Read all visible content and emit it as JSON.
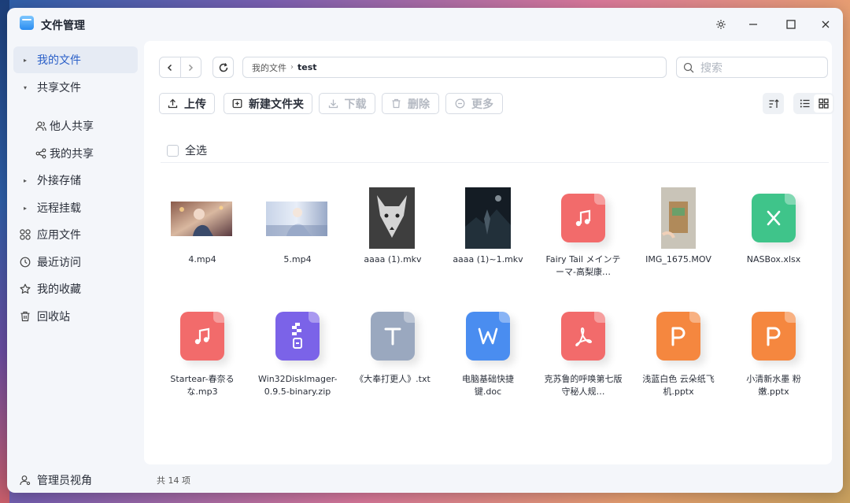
{
  "app": {
    "title": "文件管理"
  },
  "window_controls": {
    "settings": "⚙",
    "minimize": "—",
    "maximize": "☐",
    "close": "✕"
  },
  "sidebar": {
    "items": [
      {
        "label": "我的文件",
        "icon": "caret-right",
        "active": true
      },
      {
        "label": "共享文件",
        "icon": "caret-down"
      },
      {
        "label": "他人共享",
        "icon": "users-icon",
        "sub": true
      },
      {
        "label": "我的共享",
        "icon": "share-icon",
        "sub": true
      },
      {
        "label": "外接存储",
        "icon": "caret-right"
      },
      {
        "label": "远程挂载",
        "icon": "caret-right"
      },
      {
        "label": "应用文件",
        "icon": "apps-icon"
      },
      {
        "label": "最近访问",
        "icon": "clock-icon"
      },
      {
        "label": "我的收藏",
        "icon": "star-icon"
      },
      {
        "label": "回收站",
        "icon": "trash-icon"
      }
    ],
    "admin_view": "管理员视角"
  },
  "path": {
    "root": "我的文件",
    "current": "test"
  },
  "search": {
    "placeholder": "搜索"
  },
  "toolbar": {
    "upload": "上传",
    "new_folder": "新建文件夹",
    "download": "下载",
    "delete": "删除",
    "more": "更多"
  },
  "select_all": "全选",
  "files": [
    {
      "name": "4.mp4",
      "kind": "video-thumb"
    },
    {
      "name": "5.mp4",
      "kind": "video-thumb"
    },
    {
      "name": "aaaa (1).mkv",
      "kind": "video-thumb"
    },
    {
      "name": "aaaa (1)~1.mkv",
      "kind": "video-thumb"
    },
    {
      "name": "Fairy Tail メインテーマ-高梨康…",
      "kind": "music",
      "color": "#f26b6b"
    },
    {
      "name": "IMG_1675.MOV",
      "kind": "video-thumb"
    },
    {
      "name": "NASBox.xlsx",
      "kind": "excel",
      "color": "#3fc48a"
    },
    {
      "name": "Startear-春奈るな.mp3",
      "kind": "music",
      "color": "#f26b6b"
    },
    {
      "name": "Win32DiskImager-0.9.5-binary.zip",
      "kind": "zip",
      "color": "#7b63e8"
    },
    {
      "name": "《大奉打更人》.txt",
      "kind": "text",
      "color": "#9aa8bf"
    },
    {
      "name": "电脑基础快捷键.doc",
      "kind": "word",
      "color": "#4a8df0"
    },
    {
      "name": "克苏鲁的呼唤第七版守秘人规…",
      "kind": "pdf",
      "color": "#f26b6b"
    },
    {
      "name": "浅蓝白色 云朵纸飞机.pptx",
      "kind": "ppt",
      "color": "#f5873f"
    },
    {
      "name": "小清新水墨 粉嫩.pptx",
      "kind": "ppt",
      "color": "#f5873f"
    }
  ],
  "footer": {
    "count": "共 14 项"
  }
}
